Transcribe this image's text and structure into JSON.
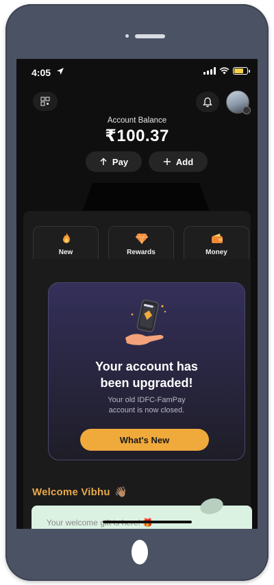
{
  "status_bar": {
    "time": "4:05"
  },
  "header": {
    "balance_label": "Account Balance",
    "balance_value": "₹100.37",
    "pay_label": "Pay",
    "add_label": "Add"
  },
  "tabs": [
    {
      "label": "New",
      "icon": "flame-icon"
    },
    {
      "label": "Rewards",
      "icon": "gem-icon"
    },
    {
      "label": "Money",
      "icon": "wallet-icon"
    }
  ],
  "promo": {
    "title_line1": "Your account has",
    "title_line2": "been upgraded!",
    "subtitle_line1": "Your old IDFC-FamPay",
    "subtitle_line2": "account is now closed.",
    "cta_label": "What's New"
  },
  "welcome": {
    "text": "Welcome Vibhu",
    "emoji": "👋🏽"
  },
  "gift": {
    "text": "Your welcome gift is here! 🎁"
  },
  "colors": {
    "accent": "#f0a93b",
    "welcome": "#e8a94a",
    "background": "#0f0f0f",
    "gift_card": "#dbf2e2"
  }
}
